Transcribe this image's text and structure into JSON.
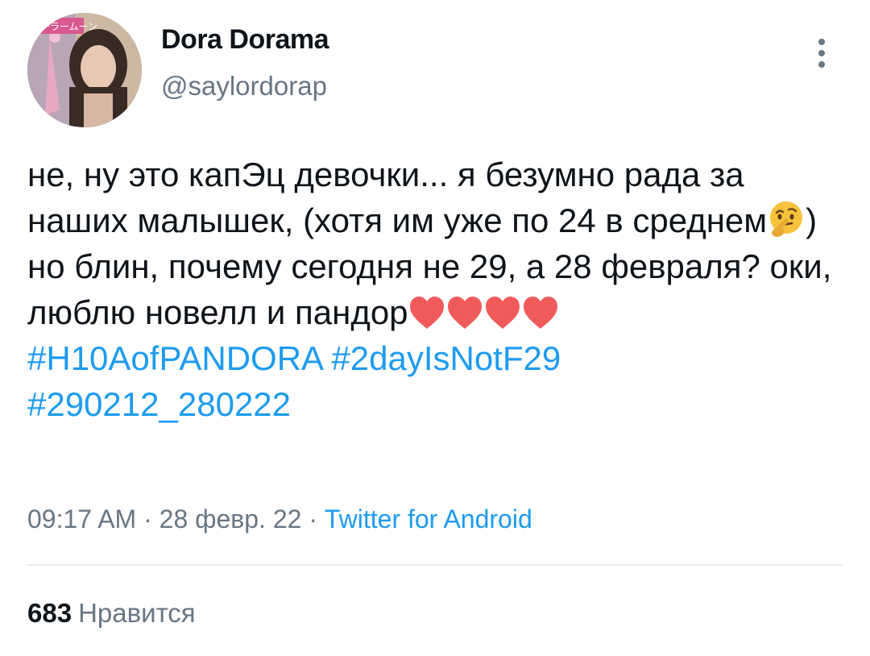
{
  "user": {
    "display_name": "Dora Dorama",
    "handle": "@saylordorap",
    "avatar_logo_text": "セーラームーン"
  },
  "tweet": {
    "text_part1": "не, ну это капЭц девочки... я безумно рада за наших малышек, (хотя им уже по 24 в среднем",
    "emoji1": "thinking-face",
    "text_part2": ") но блин, почему сегодня не 29, а 28 февраля? оки, люблю новелл и пандор",
    "hearts": [
      "red-heart",
      "red-heart",
      "red-heart",
      "red-heart"
    ],
    "hashtags": [
      "#H10AofPANDORA",
      "#2dayIsNotF29",
      "#290212_280222"
    ]
  },
  "meta": {
    "time": "09:17 AM",
    "separator": "·",
    "date": "28 февр. 22",
    "source": "Twitter for Android"
  },
  "stats": {
    "likes_count": "683",
    "likes_label": "Нравится"
  },
  "colors": {
    "link": "#1d9bf0",
    "secondary_text": "#687684",
    "primary_text": "#0f1419",
    "divider": "#e6ecf0"
  }
}
